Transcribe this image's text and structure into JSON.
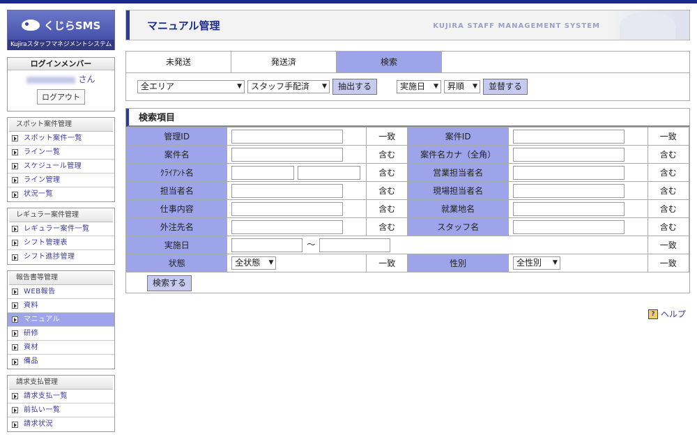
{
  "logo": {
    "brand": "くじらSMS",
    "sub": "Kujiraスタッフマネジメントシステム"
  },
  "login": {
    "heading": "ログインメンバー",
    "suffix": "さん",
    "logout": "ログアウト"
  },
  "menu": [
    {
      "title": "スポット案件管理",
      "items": [
        "スポット案件一覧",
        "ライン一覧",
        "スケジュール管理",
        "ライン管理",
        "状況一覧"
      ]
    },
    {
      "title": "レギュラー案件管理",
      "items": [
        "レギュラー案件一覧",
        "シフト管理表",
        "シフト進捗管理"
      ]
    },
    {
      "title": "報告書等管理",
      "items": [
        "WEB報告",
        "資料",
        "マニュアル",
        "研修",
        "資材",
        "備品"
      ]
    },
    {
      "title": "請求支払管理",
      "items": [
        "請求支払一覧",
        "前払い一覧",
        "請求状況"
      ]
    }
  ],
  "header": {
    "title": "マニュアル管理",
    "system": "KUJIRA STAFF MANAGEMENT SYSTEM"
  },
  "tabs": [
    "未発送",
    "発送済",
    "検索"
  ],
  "filters": {
    "area": "全エリア",
    "staff": "スタッフ手配済",
    "extract": "抽出する",
    "sort_key": "実施日",
    "order": "昇順",
    "sort": "並替する"
  },
  "search": {
    "title": "検索項目",
    "rows": [
      {
        "l1": "管理ID",
        "m1": "一致",
        "l2": "案件ID",
        "m2": "一致"
      },
      {
        "l1": "案件名",
        "m1": "含む",
        "l2": "案件名カナ（全角）",
        "m2": "含む"
      },
      {
        "l1": "ｸﾗｲｱﾝﾄ名",
        "m1": "含む",
        "l2": "営業担当者名",
        "m2": "含む"
      },
      {
        "l1": "担当者名",
        "m1": "含む",
        "l2": "現場担当者名",
        "m2": "含む"
      },
      {
        "l1": "仕事内容",
        "m1": "含む",
        "l2": "就業地名",
        "m2": "含む"
      },
      {
        "l1": "外注先名",
        "m1": "含む",
        "l2": "スタッフ名",
        "m2": "含む"
      }
    ],
    "date_label": "実施日",
    "tilde": "～",
    "date_mode": "一致",
    "state_label": "状態",
    "state_value": "全状態",
    "state_mode": "一致",
    "gender_label": "性別",
    "gender_value": "全性別",
    "gender_mode": "一致",
    "button": "検索する"
  },
  "help": "ヘルプ"
}
